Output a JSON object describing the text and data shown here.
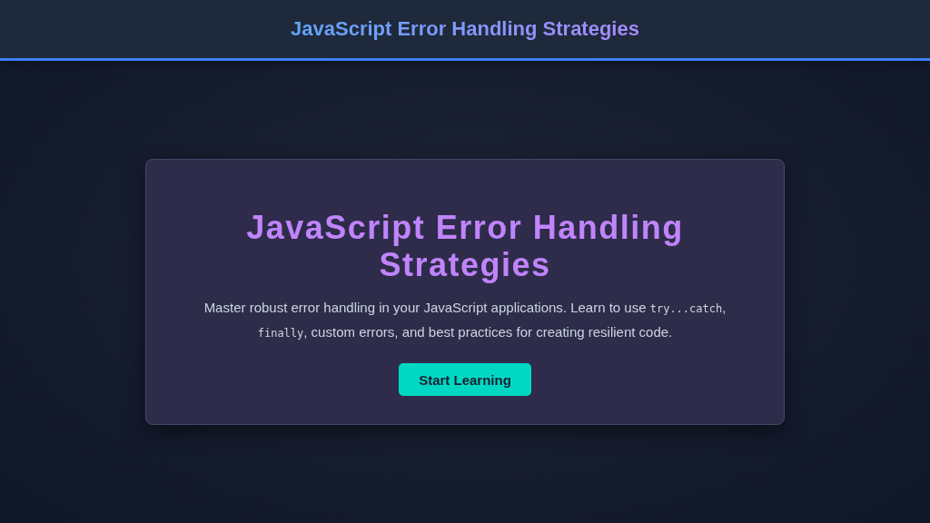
{
  "header": {
    "title": "JavaScript Error Handling Strategies"
  },
  "hero": {
    "title": "JavaScript Error Handling Strategies",
    "description": [
      {
        "kind": "text",
        "text": "Master robust error handling in your JavaScript applications. Learn to use "
      },
      {
        "kind": "code",
        "text": "try...catch"
      },
      {
        "kind": "text",
        "text": ", "
      },
      {
        "kind": "code",
        "text": "finally"
      },
      {
        "kind": "text",
        "text": ", custom errors, and best practices for creating resilient code."
      }
    ],
    "button": "Start Learning"
  }
}
